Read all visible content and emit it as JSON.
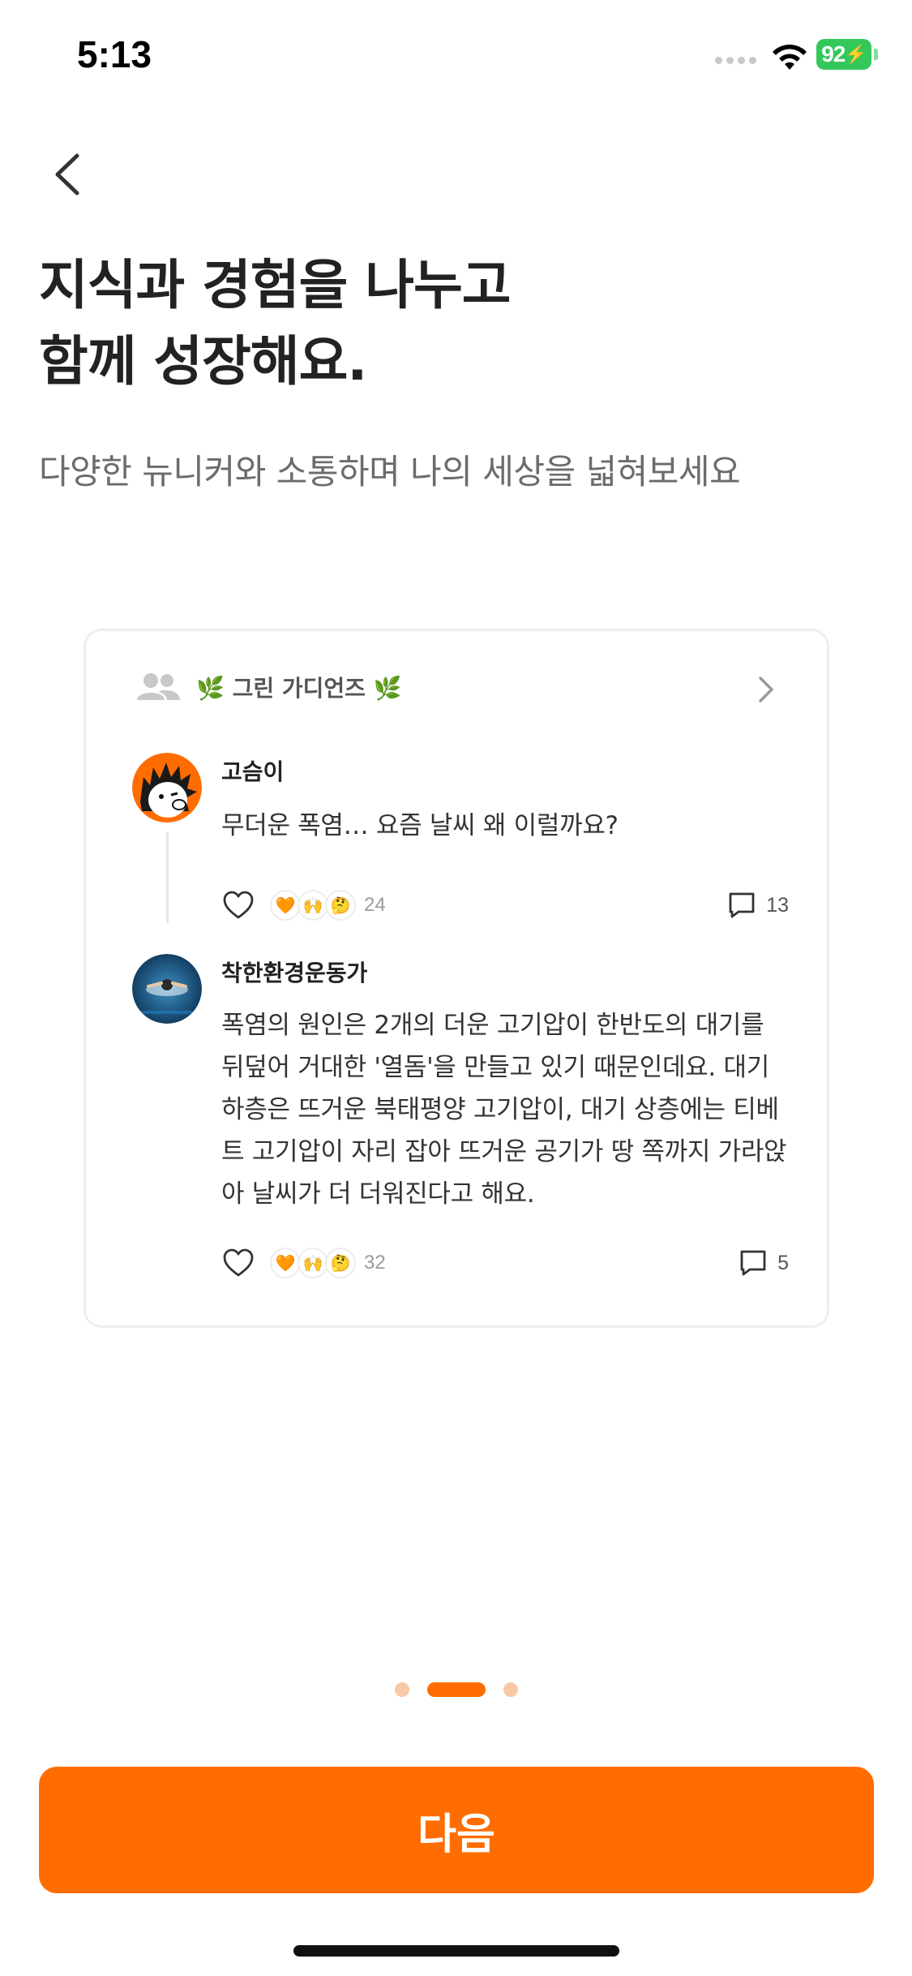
{
  "status_bar": {
    "time": "5:13",
    "battery": "92"
  },
  "intro": {
    "headline_line1": "지식과 경험을 나누고",
    "headline_line2": "함께 성장해요.",
    "subtitle": "다양한 뉴니커와 소통하며 나의 세상을 넓혀보세요"
  },
  "card": {
    "group_name": "🌿 그린 가디언즈 🌿",
    "posts": [
      {
        "author": "고슴이",
        "text": "무더운 폭염… 요즘 날씨 왜 이럴까요?",
        "reactions": [
          "🧡",
          "🙌",
          "🤔"
        ],
        "reaction_count": "24",
        "comment_count": "13"
      },
      {
        "author": "착한환경운동가",
        "text": "폭염의 원인은 2개의 더운 고기압이 한반도의 대기를 뒤덮어 거대한 '열돔'을 만들고 있기 때문인데요. 대기 하층은 뜨거운 북태평양 고기압이, 대기 상층에는 티베트 고기압이 자리 잡아 뜨거운 공기가 땅 쪽까지 가라앉아 날씨가 더 더워진다고 해요.",
        "reactions": [
          "🧡",
          "🙌",
          "🤔"
        ],
        "reaction_count": "32",
        "comment_count": "5"
      }
    ]
  },
  "pagination": {
    "total": 3,
    "current": 2
  },
  "next_button": {
    "label": "다음"
  },
  "colors": {
    "accent": "#ff6d00",
    "accent_light": "#f9c9a6",
    "battery": "#34c759"
  },
  "icons": [
    "back-chevron-icon",
    "group-people-icon",
    "chevron-right-icon",
    "heart-icon",
    "comment-icon",
    "wifi-icon"
  ]
}
